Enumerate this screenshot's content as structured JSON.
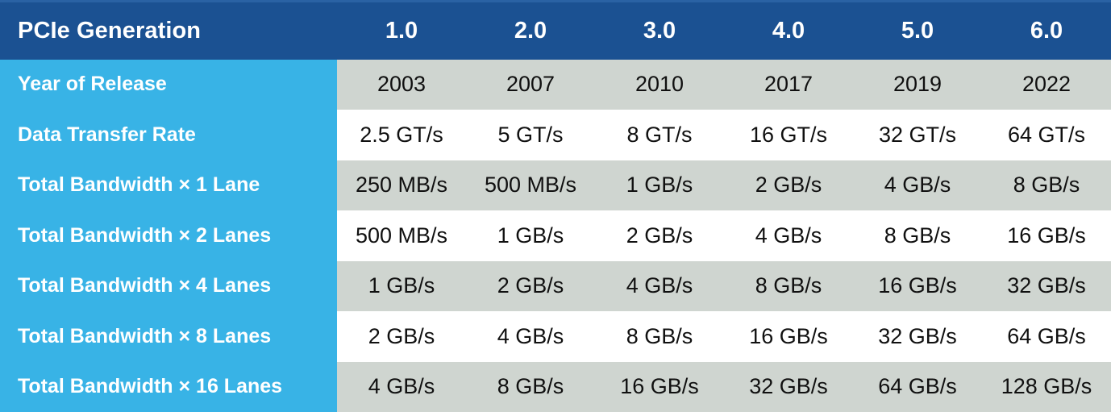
{
  "table": {
    "corner_label": "PCIe Generation",
    "generations": [
      "1.0",
      "2.0",
      "3.0",
      "4.0",
      "5.0",
      "6.0"
    ],
    "colors": {
      "header_bg": "#1B5192",
      "header_top_line": "#2A62A4",
      "label_bg": "#38B3E6",
      "label_text": "#FFFFFF",
      "row_grey": "#CFD5D0",
      "row_white": "#FFFFFF",
      "value_text": "#101010"
    },
    "rows": [
      {
        "label": "Year of Release",
        "band": "grey",
        "values": [
          "2003",
          "2007",
          "2010",
          "2017",
          "2019",
          "2022"
        ]
      },
      {
        "label": "Data Transfer Rate",
        "band": "white",
        "values": [
          "2.5 GT/s",
          "5 GT/s",
          "8 GT/s",
          "16 GT/s",
          "32 GT/s",
          "64 GT/s"
        ]
      },
      {
        "label": "Total Bandwidth × 1 Lane",
        "band": "grey",
        "values": [
          "250 MB/s",
          "500 MB/s",
          "1 GB/s",
          "2 GB/s",
          "4 GB/s",
          "8 GB/s"
        ]
      },
      {
        "label": "Total Bandwidth × 2 Lanes",
        "band": "white",
        "values": [
          "500 MB/s",
          "1 GB/s",
          "2 GB/s",
          "4 GB/s",
          "8 GB/s",
          "16 GB/s"
        ]
      },
      {
        "label": "Total Bandwidth × 4 Lanes",
        "band": "grey",
        "values": [
          "1 GB/s",
          "2 GB/s",
          "4 GB/s",
          "8 GB/s",
          "16 GB/s",
          "32 GB/s"
        ]
      },
      {
        "label": "Total Bandwidth × 8 Lanes",
        "band": "white",
        "values": [
          "2 GB/s",
          "4 GB/s",
          "8 GB/s",
          "16 GB/s",
          "32 GB/s",
          "64 GB/s"
        ]
      },
      {
        "label": "Total Bandwidth × 16 Lanes",
        "band": "grey",
        "values": [
          "4 GB/s",
          "8 GB/s",
          "16 GB/s",
          "32 GB/s",
          "64 GB/s",
          "128 GB/s"
        ]
      }
    ]
  }
}
